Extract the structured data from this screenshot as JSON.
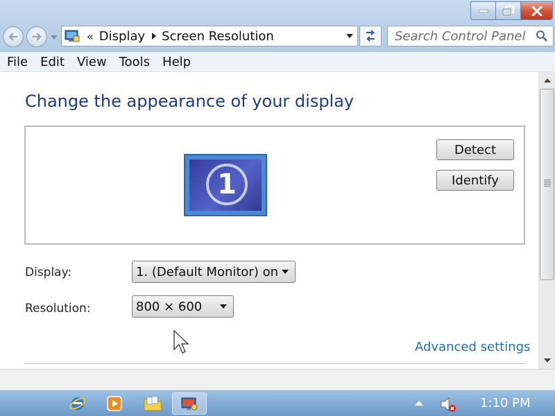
{
  "window": {
    "buttons": {
      "minimize": "minimize",
      "maximize": "restore",
      "close": "close"
    }
  },
  "address": {
    "overflow": "«",
    "crumbs": [
      "Display",
      "Screen Resolution"
    ]
  },
  "search": {
    "placeholder": "Search Control Panel"
  },
  "menu": {
    "items": [
      "File",
      "Edit",
      "View",
      "Tools",
      "Help"
    ]
  },
  "page": {
    "title": "Change the appearance of your display",
    "monitor_number": "1",
    "detect_label": "Detect",
    "identify_label": "Identify",
    "display_label": "Display:",
    "display_value": "1. (Default Monitor) on",
    "resolution_label": "Resolution:",
    "resolution_value": "800 × 600",
    "advanced_link": "Advanced settings"
  },
  "taskbar": {
    "icons": [
      "internet-explorer-icon",
      "media-player-icon",
      "windows-explorer-icon",
      "display-settings-icon"
    ],
    "clock": "1:10 PM"
  },
  "colors": {
    "title": "#1e3a8c",
    "link": "#1f6fb5",
    "taskbar": "#86afd8"
  }
}
